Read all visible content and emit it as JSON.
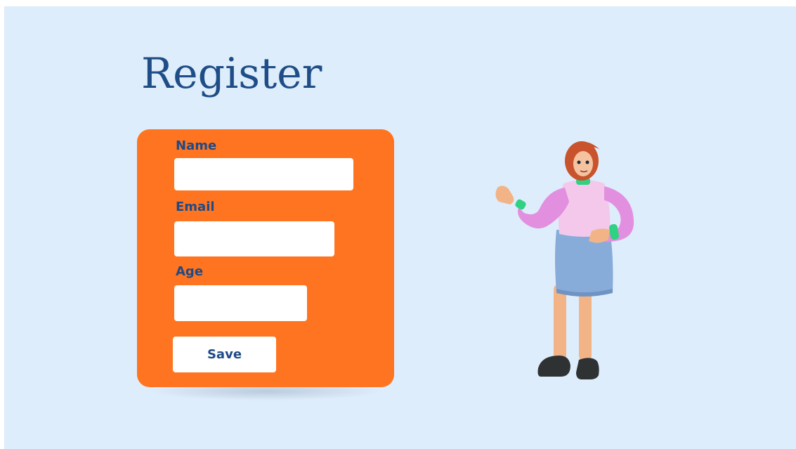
{
  "page": {
    "title": "Register"
  },
  "form": {
    "fields": [
      {
        "label": "Name",
        "value": "",
        "placeholder": ""
      },
      {
        "label": "Email",
        "value": "",
        "placeholder": ""
      },
      {
        "label": "Age",
        "value": "",
        "placeholder": ""
      }
    ],
    "save_label": "Save"
  },
  "colors": {
    "background": "#deedfb",
    "card": "#ff7420",
    "text": "#1f4a86",
    "field": "#ffffff"
  },
  "illustration": {
    "icon": "person-illustration-icon"
  }
}
